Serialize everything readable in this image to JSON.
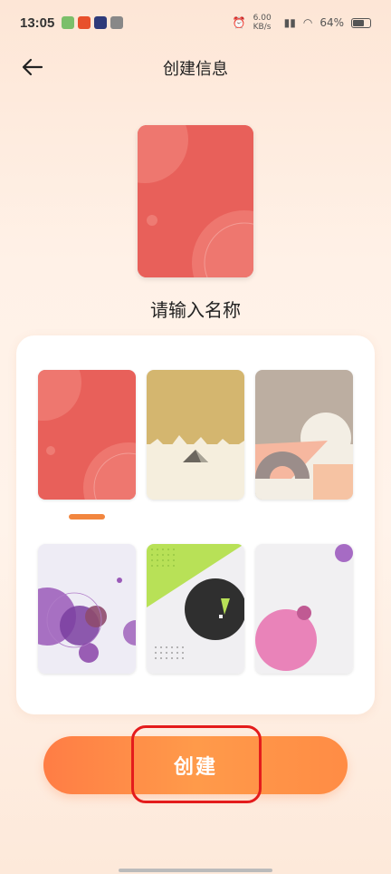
{
  "status_bar": {
    "time": "13:05",
    "network_speed": "6.00 KB/s",
    "battery_text": "64%"
  },
  "header": {
    "title": "创建信息",
    "back_icon": "arrow-left-icon"
  },
  "preview": {
    "name_prompt": "请输入名称"
  },
  "covers": {
    "selected_index": 0,
    "items": [
      {
        "name": "red-circles",
        "color": "#e8605a"
      },
      {
        "name": "gold-mountains",
        "color": "#d4b66f"
      },
      {
        "name": "taupe-geometric",
        "color": "#bcaea1"
      },
      {
        "name": "purple-bubbles",
        "color": "#9b59b6"
      },
      {
        "name": "green-black-circle",
        "color": "#b8e157"
      },
      {
        "name": "pink-circle",
        "color": "#e983b9"
      }
    ]
  },
  "actions": {
    "create_label": "创建"
  },
  "colors": {
    "accent": "#ff8c45",
    "highlight": "#e41c1c"
  }
}
